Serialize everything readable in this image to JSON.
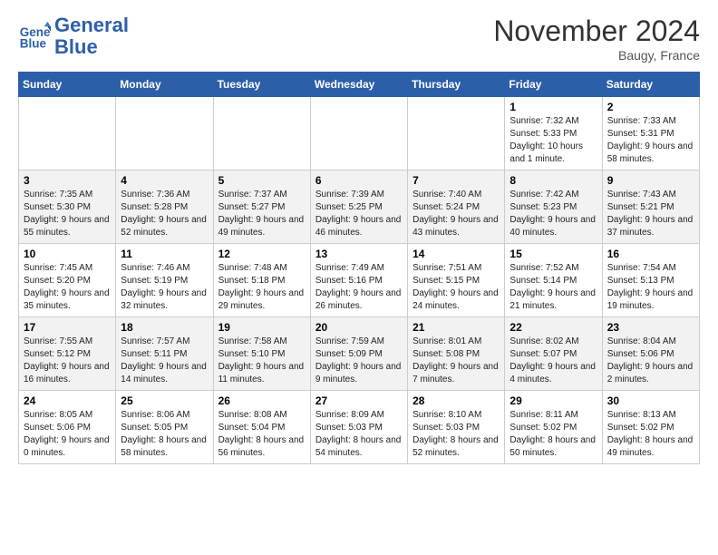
{
  "header": {
    "logo_line1": "General",
    "logo_line2": "Blue",
    "month_title": "November 2024",
    "location": "Baugy, France"
  },
  "weekdays": [
    "Sunday",
    "Monday",
    "Tuesday",
    "Wednesday",
    "Thursday",
    "Friday",
    "Saturday"
  ],
  "weeks": [
    [
      {
        "day": "",
        "info": ""
      },
      {
        "day": "",
        "info": ""
      },
      {
        "day": "",
        "info": ""
      },
      {
        "day": "",
        "info": ""
      },
      {
        "day": "",
        "info": ""
      },
      {
        "day": "1",
        "info": "Sunrise: 7:32 AM\nSunset: 5:33 PM\nDaylight: 10 hours\nand 1 minute."
      },
      {
        "day": "2",
        "info": "Sunrise: 7:33 AM\nSunset: 5:31 PM\nDaylight: 9 hours\nand 58 minutes."
      }
    ],
    [
      {
        "day": "3",
        "info": "Sunrise: 7:35 AM\nSunset: 5:30 PM\nDaylight: 9 hours\nand 55 minutes."
      },
      {
        "day": "4",
        "info": "Sunrise: 7:36 AM\nSunset: 5:28 PM\nDaylight: 9 hours\nand 52 minutes."
      },
      {
        "day": "5",
        "info": "Sunrise: 7:37 AM\nSunset: 5:27 PM\nDaylight: 9 hours\nand 49 minutes."
      },
      {
        "day": "6",
        "info": "Sunrise: 7:39 AM\nSunset: 5:25 PM\nDaylight: 9 hours\nand 46 minutes."
      },
      {
        "day": "7",
        "info": "Sunrise: 7:40 AM\nSunset: 5:24 PM\nDaylight: 9 hours\nand 43 minutes."
      },
      {
        "day": "8",
        "info": "Sunrise: 7:42 AM\nSunset: 5:23 PM\nDaylight: 9 hours\nand 40 minutes."
      },
      {
        "day": "9",
        "info": "Sunrise: 7:43 AM\nSunset: 5:21 PM\nDaylight: 9 hours\nand 37 minutes."
      }
    ],
    [
      {
        "day": "10",
        "info": "Sunrise: 7:45 AM\nSunset: 5:20 PM\nDaylight: 9 hours\nand 35 minutes."
      },
      {
        "day": "11",
        "info": "Sunrise: 7:46 AM\nSunset: 5:19 PM\nDaylight: 9 hours\nand 32 minutes."
      },
      {
        "day": "12",
        "info": "Sunrise: 7:48 AM\nSunset: 5:18 PM\nDaylight: 9 hours\nand 29 minutes."
      },
      {
        "day": "13",
        "info": "Sunrise: 7:49 AM\nSunset: 5:16 PM\nDaylight: 9 hours\nand 26 minutes."
      },
      {
        "day": "14",
        "info": "Sunrise: 7:51 AM\nSunset: 5:15 PM\nDaylight: 9 hours\nand 24 minutes."
      },
      {
        "day": "15",
        "info": "Sunrise: 7:52 AM\nSunset: 5:14 PM\nDaylight: 9 hours\nand 21 minutes."
      },
      {
        "day": "16",
        "info": "Sunrise: 7:54 AM\nSunset: 5:13 PM\nDaylight: 9 hours\nand 19 minutes."
      }
    ],
    [
      {
        "day": "17",
        "info": "Sunrise: 7:55 AM\nSunset: 5:12 PM\nDaylight: 9 hours\nand 16 minutes."
      },
      {
        "day": "18",
        "info": "Sunrise: 7:57 AM\nSunset: 5:11 PM\nDaylight: 9 hours\nand 14 minutes."
      },
      {
        "day": "19",
        "info": "Sunrise: 7:58 AM\nSunset: 5:10 PM\nDaylight: 9 hours\nand 11 minutes."
      },
      {
        "day": "20",
        "info": "Sunrise: 7:59 AM\nSunset: 5:09 PM\nDaylight: 9 hours\nand 9 minutes."
      },
      {
        "day": "21",
        "info": "Sunrise: 8:01 AM\nSunset: 5:08 PM\nDaylight: 9 hours\nand 7 minutes."
      },
      {
        "day": "22",
        "info": "Sunrise: 8:02 AM\nSunset: 5:07 PM\nDaylight: 9 hours\nand 4 minutes."
      },
      {
        "day": "23",
        "info": "Sunrise: 8:04 AM\nSunset: 5:06 PM\nDaylight: 9 hours\nand 2 minutes."
      }
    ],
    [
      {
        "day": "24",
        "info": "Sunrise: 8:05 AM\nSunset: 5:06 PM\nDaylight: 9 hours\nand 0 minutes."
      },
      {
        "day": "25",
        "info": "Sunrise: 8:06 AM\nSunset: 5:05 PM\nDaylight: 8 hours\nand 58 minutes."
      },
      {
        "day": "26",
        "info": "Sunrise: 8:08 AM\nSunset: 5:04 PM\nDaylight: 8 hours\nand 56 minutes."
      },
      {
        "day": "27",
        "info": "Sunrise: 8:09 AM\nSunset: 5:03 PM\nDaylight: 8 hours\nand 54 minutes."
      },
      {
        "day": "28",
        "info": "Sunrise: 8:10 AM\nSunset: 5:03 PM\nDaylight: 8 hours\nand 52 minutes."
      },
      {
        "day": "29",
        "info": "Sunrise: 8:11 AM\nSunset: 5:02 PM\nDaylight: 8 hours\nand 50 minutes."
      },
      {
        "day": "30",
        "info": "Sunrise: 8:13 AM\nSunset: 5:02 PM\nDaylight: 8 hours\nand 49 minutes."
      }
    ]
  ]
}
